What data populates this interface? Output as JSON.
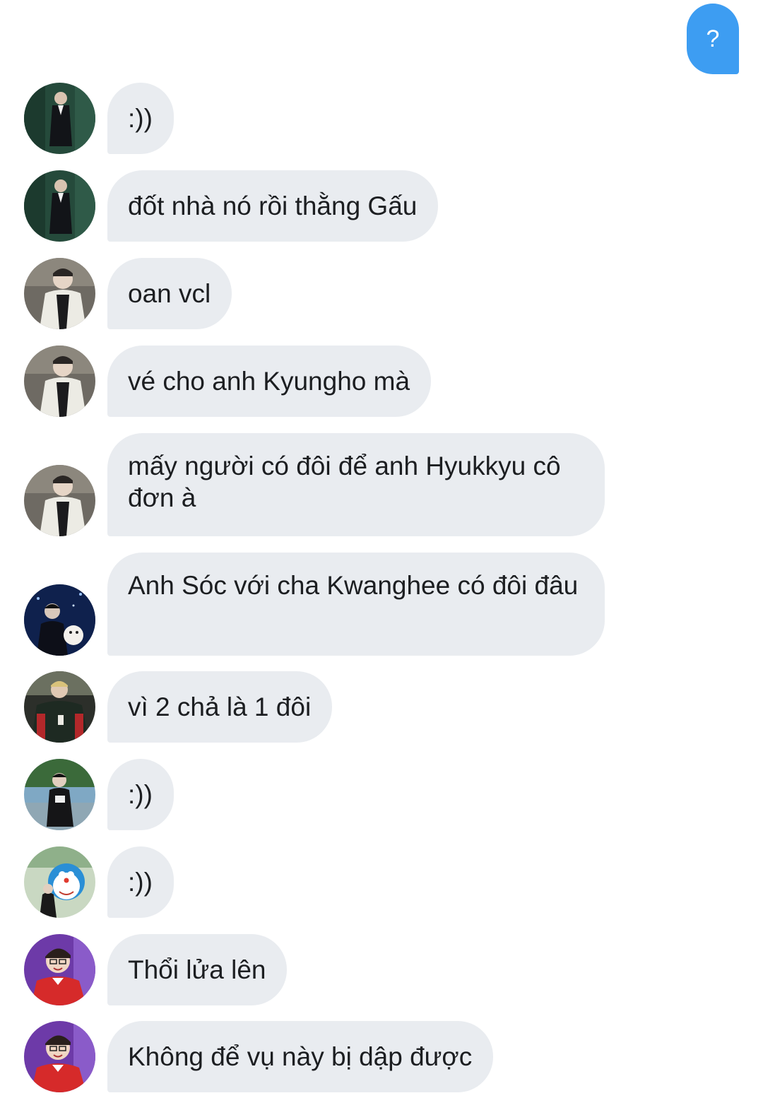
{
  "sent_message": {
    "text": "?"
  },
  "messages": [
    {
      "text": ":))",
      "avatar": "avatar-man-black-suit"
    },
    {
      "text": "đốt nhà nó rồi thằng Gấu",
      "avatar": "avatar-man-black-suit"
    },
    {
      "text": "oan vcl",
      "avatar": "avatar-man-white-jacket"
    },
    {
      "text": "vé cho anh Kyungho mà",
      "avatar": "avatar-man-white-jacket"
    },
    {
      "text": "mấy người có đôi để anh Hyukkyu cô đơn à",
      "avatar": "avatar-man-white-jacket"
    },
    {
      "text": "Anh Sóc với cha Kwanghee có đôi đâu",
      "avatar": "avatar-man-with-dog"
    },
    {
      "text": "vì 2 chả là 1 đôi",
      "avatar": "avatar-man-varsity-jacket"
    },
    {
      "text": ":))",
      "avatar": "avatar-man-crouching-outdoors"
    },
    {
      "text": ":))",
      "avatar": "avatar-doraemon-mural"
    },
    {
      "text": "Thổi lửa lên",
      "avatar": "avatar-man-red-jersey"
    },
    {
      "text": "Không để vụ này bị dập được",
      "avatar": "avatar-man-red-jersey"
    }
  ],
  "colors": {
    "sent_bubble": "#3d9df2",
    "received_bubble": "#e9ecf0",
    "received_text": "#1c1e21",
    "background": "#ffffff"
  }
}
